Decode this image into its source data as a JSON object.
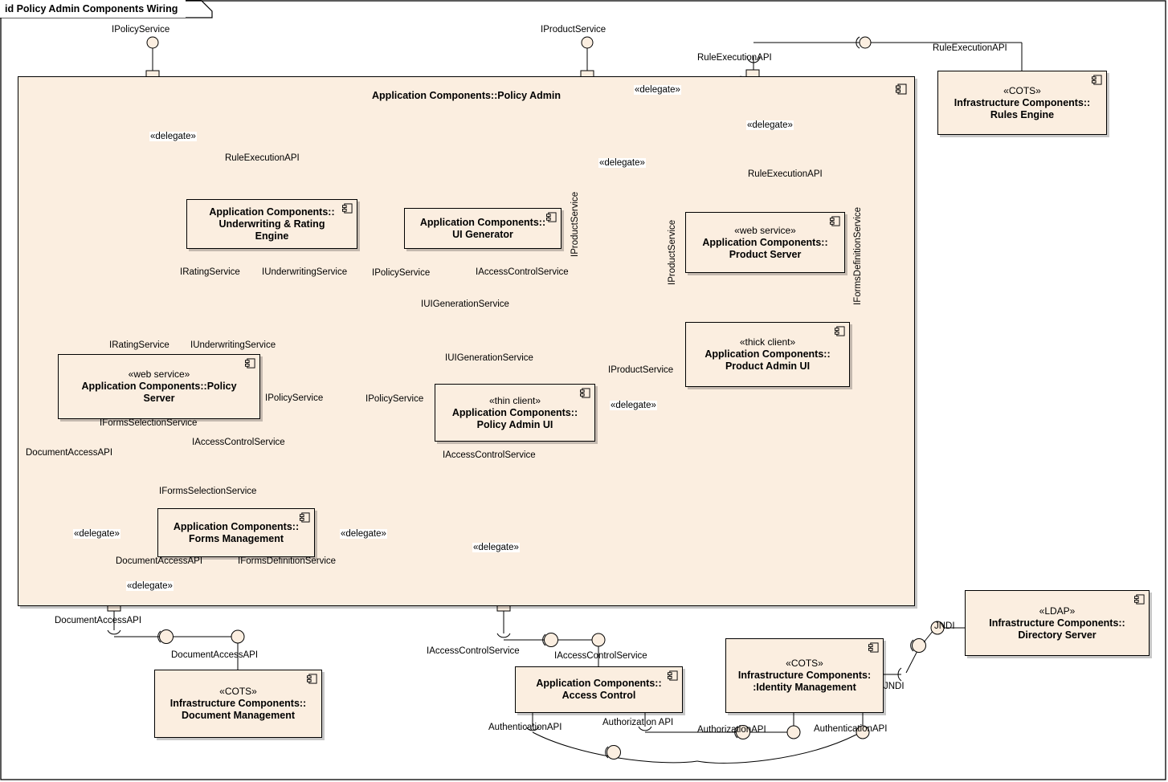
{
  "diagram": {
    "frame_label": "id Policy Admin Components Wiring",
    "container_title": "Application Components::Policy Admin",
    "colors": {
      "component_fill": "#FBEEE0",
      "line": "#000000",
      "page_background": "#FFFFFF"
    }
  },
  "components": [
    {
      "id": "underwriting",
      "stereotype": "",
      "name_line1": "Application Components::",
      "name_line2": "Underwriting & Rating",
      "name_line3": "Engine"
    },
    {
      "id": "ui_generator",
      "stereotype": "",
      "name_line1": "Application Components::",
      "name_line2": "UI Generator",
      "name_line3": ""
    },
    {
      "id": "product_server",
      "stereotype": "«web service»",
      "name_line1": "Application Components::",
      "name_line2": "Product Server",
      "name_line3": ""
    },
    {
      "id": "rules_engine",
      "stereotype": "«COTS»",
      "name_line1": "Infrastructure Components::",
      "name_line2": "Rules Engine",
      "name_line3": ""
    },
    {
      "id": "policy_server",
      "stereotype": "«web service»",
      "name_line1": "Application Components::Policy",
      "name_line2": "Server",
      "name_line3": ""
    },
    {
      "id": "policy_admin_ui",
      "stereotype": "«thin client»",
      "name_line1": "Application Components::",
      "name_line2": "Policy Admin UI",
      "name_line3": ""
    },
    {
      "id": "product_admin_ui",
      "stereotype": "«thick client»",
      "name_line1": "Application Components::",
      "name_line2": "Product Admin UI",
      "name_line3": ""
    },
    {
      "id": "forms_management",
      "stereotype": "",
      "name_line1": "Application Components::",
      "name_line2": "Forms Management",
      "name_line3": ""
    },
    {
      "id": "document_management",
      "stereotype": "«COTS»",
      "name_line1": "Infrastructure Components::",
      "name_line2": "Document Management",
      "name_line3": ""
    },
    {
      "id": "access_control",
      "stereotype": "",
      "name_line1": "Application Components::",
      "name_line2": "Access Control",
      "name_line3": ""
    },
    {
      "id": "identity_management",
      "stereotype": "«COTS»",
      "name_line1": "Infrastructure Components:",
      "name_line2": ":Identity Management",
      "name_line3": ""
    },
    {
      "id": "directory_server",
      "stereotype": "«LDAP»",
      "name_line1": "Infrastructure Components::",
      "name_line2": "Directory Server",
      "name_line3": ""
    }
  ],
  "labels": {
    "l_ipolicyservice_top": "IPolicyService",
    "l_iproductservice_top": "IProductService",
    "l_ruleexecutionapi_port": "RuleExecutionAPI",
    "l_ruleexecutionapi_engine": "RuleExecutionAPI",
    "l_delegate_1": "«delegate»",
    "l_ruleexecutionapi_uw": "RuleExecutionAPI",
    "l_delegate_2": "«delegate»",
    "l_delegate_3": "«delegate»",
    "l_delegate_ps": "«delegate»",
    "l_ruleexecutionapi_ps": "RuleExecutionAPI",
    "l_iratingservice_a": "IRatingService",
    "l_iunderwritingservice_a": "IUnderwritingService",
    "l_ipolicyservice_uigen": "IPolicyService",
    "l_iaccesscontrolservice_uigen": "IAccessControlService",
    "l_iproductservice_vert1": "IProductService",
    "l_iproductservice_vert2": "IProductService",
    "l_iformsdefinitionservice_vert": "IFormsDefinitionService",
    "l_iuigenerationservice_a": "IUIGenerationService",
    "l_iuigenerationservice_b": "IUIGenerationService",
    "l_iratingservice_b": "IRatingService",
    "l_iunderwritingservice_b": "IUnderwritingService",
    "l_ipolicyservice_port_ps": "IPolicyService",
    "l_ipolicyservice_padmin": "IPolicyService",
    "l_iproductservice_padminui": "IProductService",
    "l_delegate_prod": "«delegate»",
    "l_iformsselectionservice_a": "IFormsSelectionService",
    "l_iaccesscontrolservice_ps": "IAccessControlService",
    "l_documentaccessapi_a": "DocumentAccessAPI",
    "l_iformsselectionservice_b": "IFormsSelectionService",
    "l_delegate_doc": "«delegate»",
    "l_delegate_ac1": "«delegate»",
    "l_documentaccessapi_b": "DocumentAccessAPI",
    "l_iformsdefinitionservice_fm": "IFormsDefinitionService",
    "l_delegate_doc2": "«delegate»",
    "l_iaccesscontrolservice_pui": "IAccessControlService",
    "l_delegate_ac2": "«delegate»",
    "l_documentaccessapi_port": "DocumentAccessAPI",
    "l_documentaccessapi_dm": "DocumentAccessAPI",
    "l_iaccesscontrolservice_port": "IAccessControlService",
    "l_iaccesscontrolservice_ac": "IAccessControlService",
    "l_authenticationapi_ac": "AuthenticationAPI",
    "l_authorizationapi_ac": "Authorization API",
    "l_authorizationapi_im": "AuthorizationAPI",
    "l_authenticationapi_im": "AuthenticationAPI",
    "l_jndi_im": "JNDI",
    "l_jndi_ds": "JNDI",
    "l_ruleexecutionapi_right": "RuleExecutionAPI"
  }
}
